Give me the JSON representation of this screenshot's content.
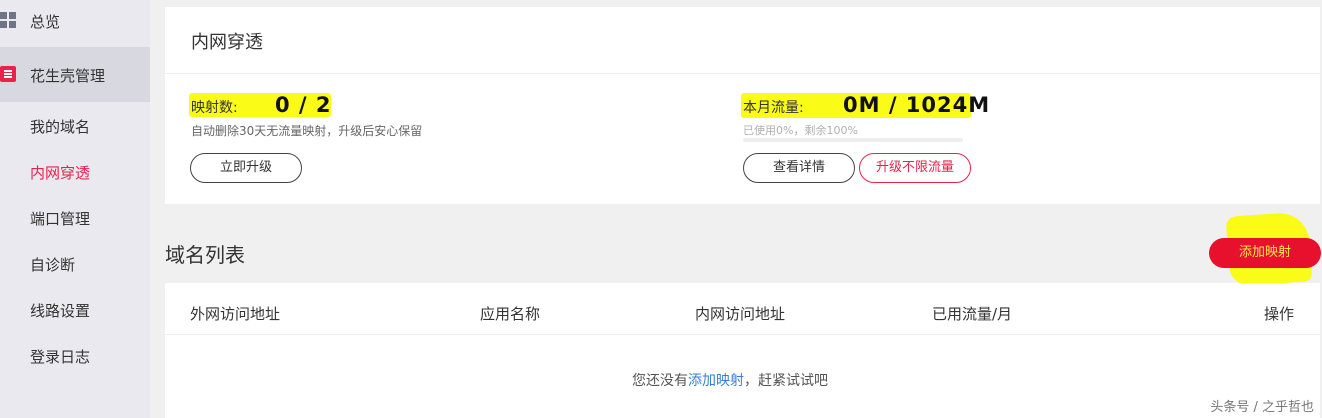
{
  "sidebar": {
    "overview": "总览",
    "section": "花生壳管理",
    "items": [
      {
        "label": "我的域名",
        "active": false
      },
      {
        "label": "内网穿透",
        "active": true
      },
      {
        "label": "端口管理",
        "active": false
      },
      {
        "label": "自诊断",
        "active": false
      },
      {
        "label": "线路设置",
        "active": false
      },
      {
        "label": "登录日志",
        "active": false
      }
    ]
  },
  "card": {
    "title": "内网穿透",
    "mapping": {
      "label": "映射数:",
      "value": "0 / 2",
      "hint": "自动删除30天无流量映射，升级后安心保留",
      "button": "立即升级"
    },
    "traffic": {
      "label": "本月流量:",
      "value": "0M / 1024M",
      "hint": "已使用0%，剩余100%",
      "used_fraction": 0,
      "details_button": "查看详情",
      "upgrade_button": "升级不限流量"
    }
  },
  "domain_list": {
    "title": "域名列表",
    "add_button": "添加映射",
    "columns": [
      "外网访问地址",
      "应用名称",
      "内网访问地址",
      "已用流量/月",
      "操作"
    ],
    "empty": {
      "before": "您还没有",
      "link": "添加映射",
      "after": "，赶紧试试吧"
    }
  },
  "watermark": "头条号 / 之乎哲也",
  "colors": {
    "accent": "#e8224a",
    "highlight": "#fbfb18",
    "link": "#3a7fd5"
  }
}
